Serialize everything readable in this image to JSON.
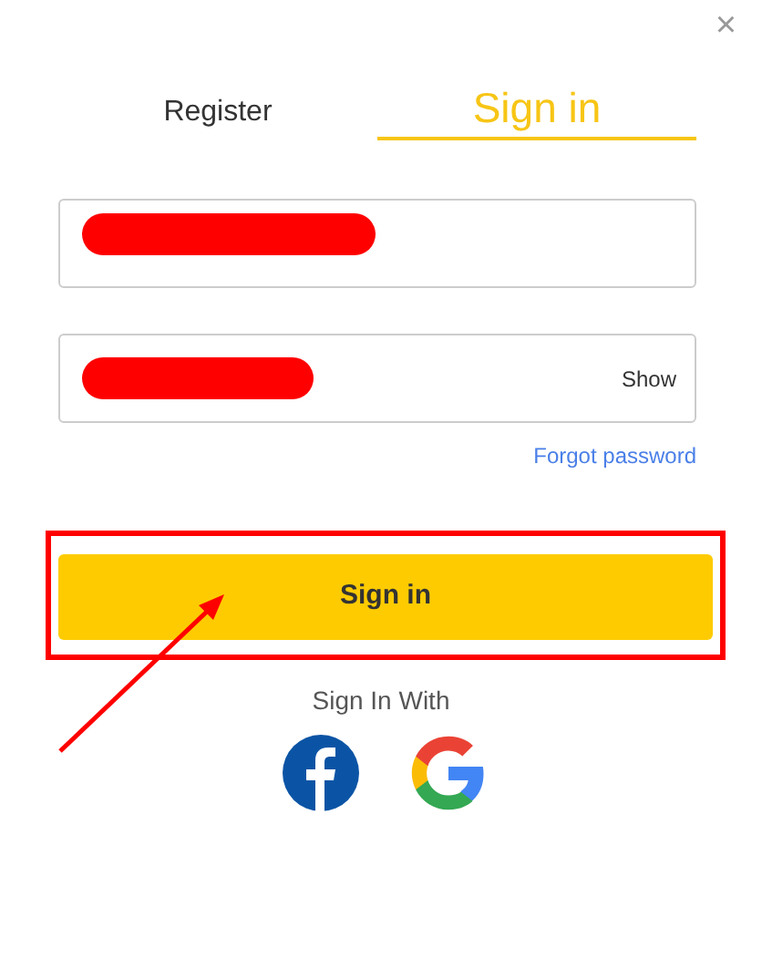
{
  "close": "×",
  "tabs": [
    {
      "label": "Register",
      "selected": false
    },
    {
      "label": "Sign in",
      "selected": true
    }
  ],
  "fields": [
    {
      "kind": "plain"
    },
    {
      "kind": "password",
      "toggle": "Show"
    }
  ],
  "forgot_link": "Forgot password",
  "submit": {
    "label": "Sign in",
    "highlighted": true
  },
  "social_heading": "Sign In With",
  "social": [
    {
      "kind": "facebook"
    },
    {
      "kind": "google"
    }
  ]
}
